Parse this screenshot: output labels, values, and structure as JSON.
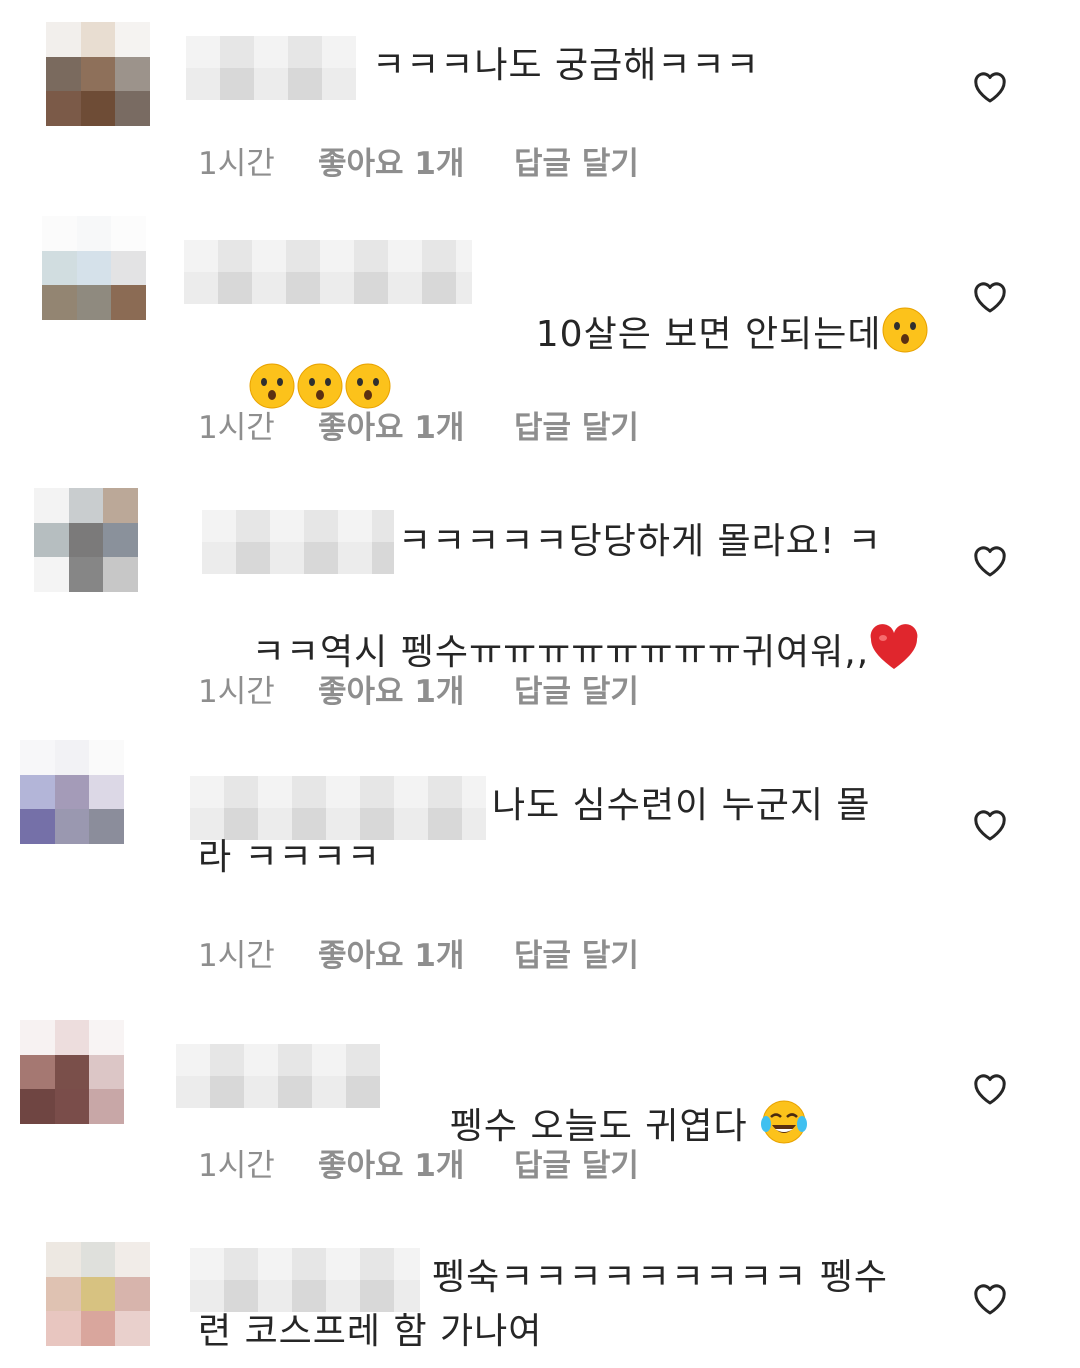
{
  "meta": {
    "time": "1시간",
    "likes": "좋아요 1개",
    "reply": "답글 달기"
  },
  "comments": [
    {
      "line1": "ㅋㅋㅋ나도 궁금해ㅋㅋㅋ",
      "line2": ""
    },
    {
      "line1": "10살은 보면 안되는데",
      "line2": ""
    },
    {
      "line1": "ㅋㅋㅋㅋㅋ당당하게 몰라요! ㅋ",
      "line2": "ㅋㅋ역시 펭수ㅠㅠㅠㅠㅠㅠㅠㅠ귀여워,,"
    },
    {
      "line1": "나도 심수련이 누군지 몰",
      "line2": "라 ㅋㅋㅋㅋ"
    },
    {
      "line1": "펭수 오늘도 귀엽다",
      "line2": ""
    },
    {
      "line1": "펭숙ㅋㅋㅋㅋㅋㅋㅋㅋㅋ 펭수",
      "line2": "련 코스프레 함 가나여"
    }
  ],
  "icons": {
    "like": "heart-outline-icon",
    "emoji_hushed": "hushed-face-emoji",
    "emoji_heart": "red-heart-emoji",
    "emoji_laugh": "tears-of-joy-emoji"
  },
  "colors": {
    "text": "#262626",
    "meta": "#8e8e8e",
    "background": "#ffffff"
  }
}
